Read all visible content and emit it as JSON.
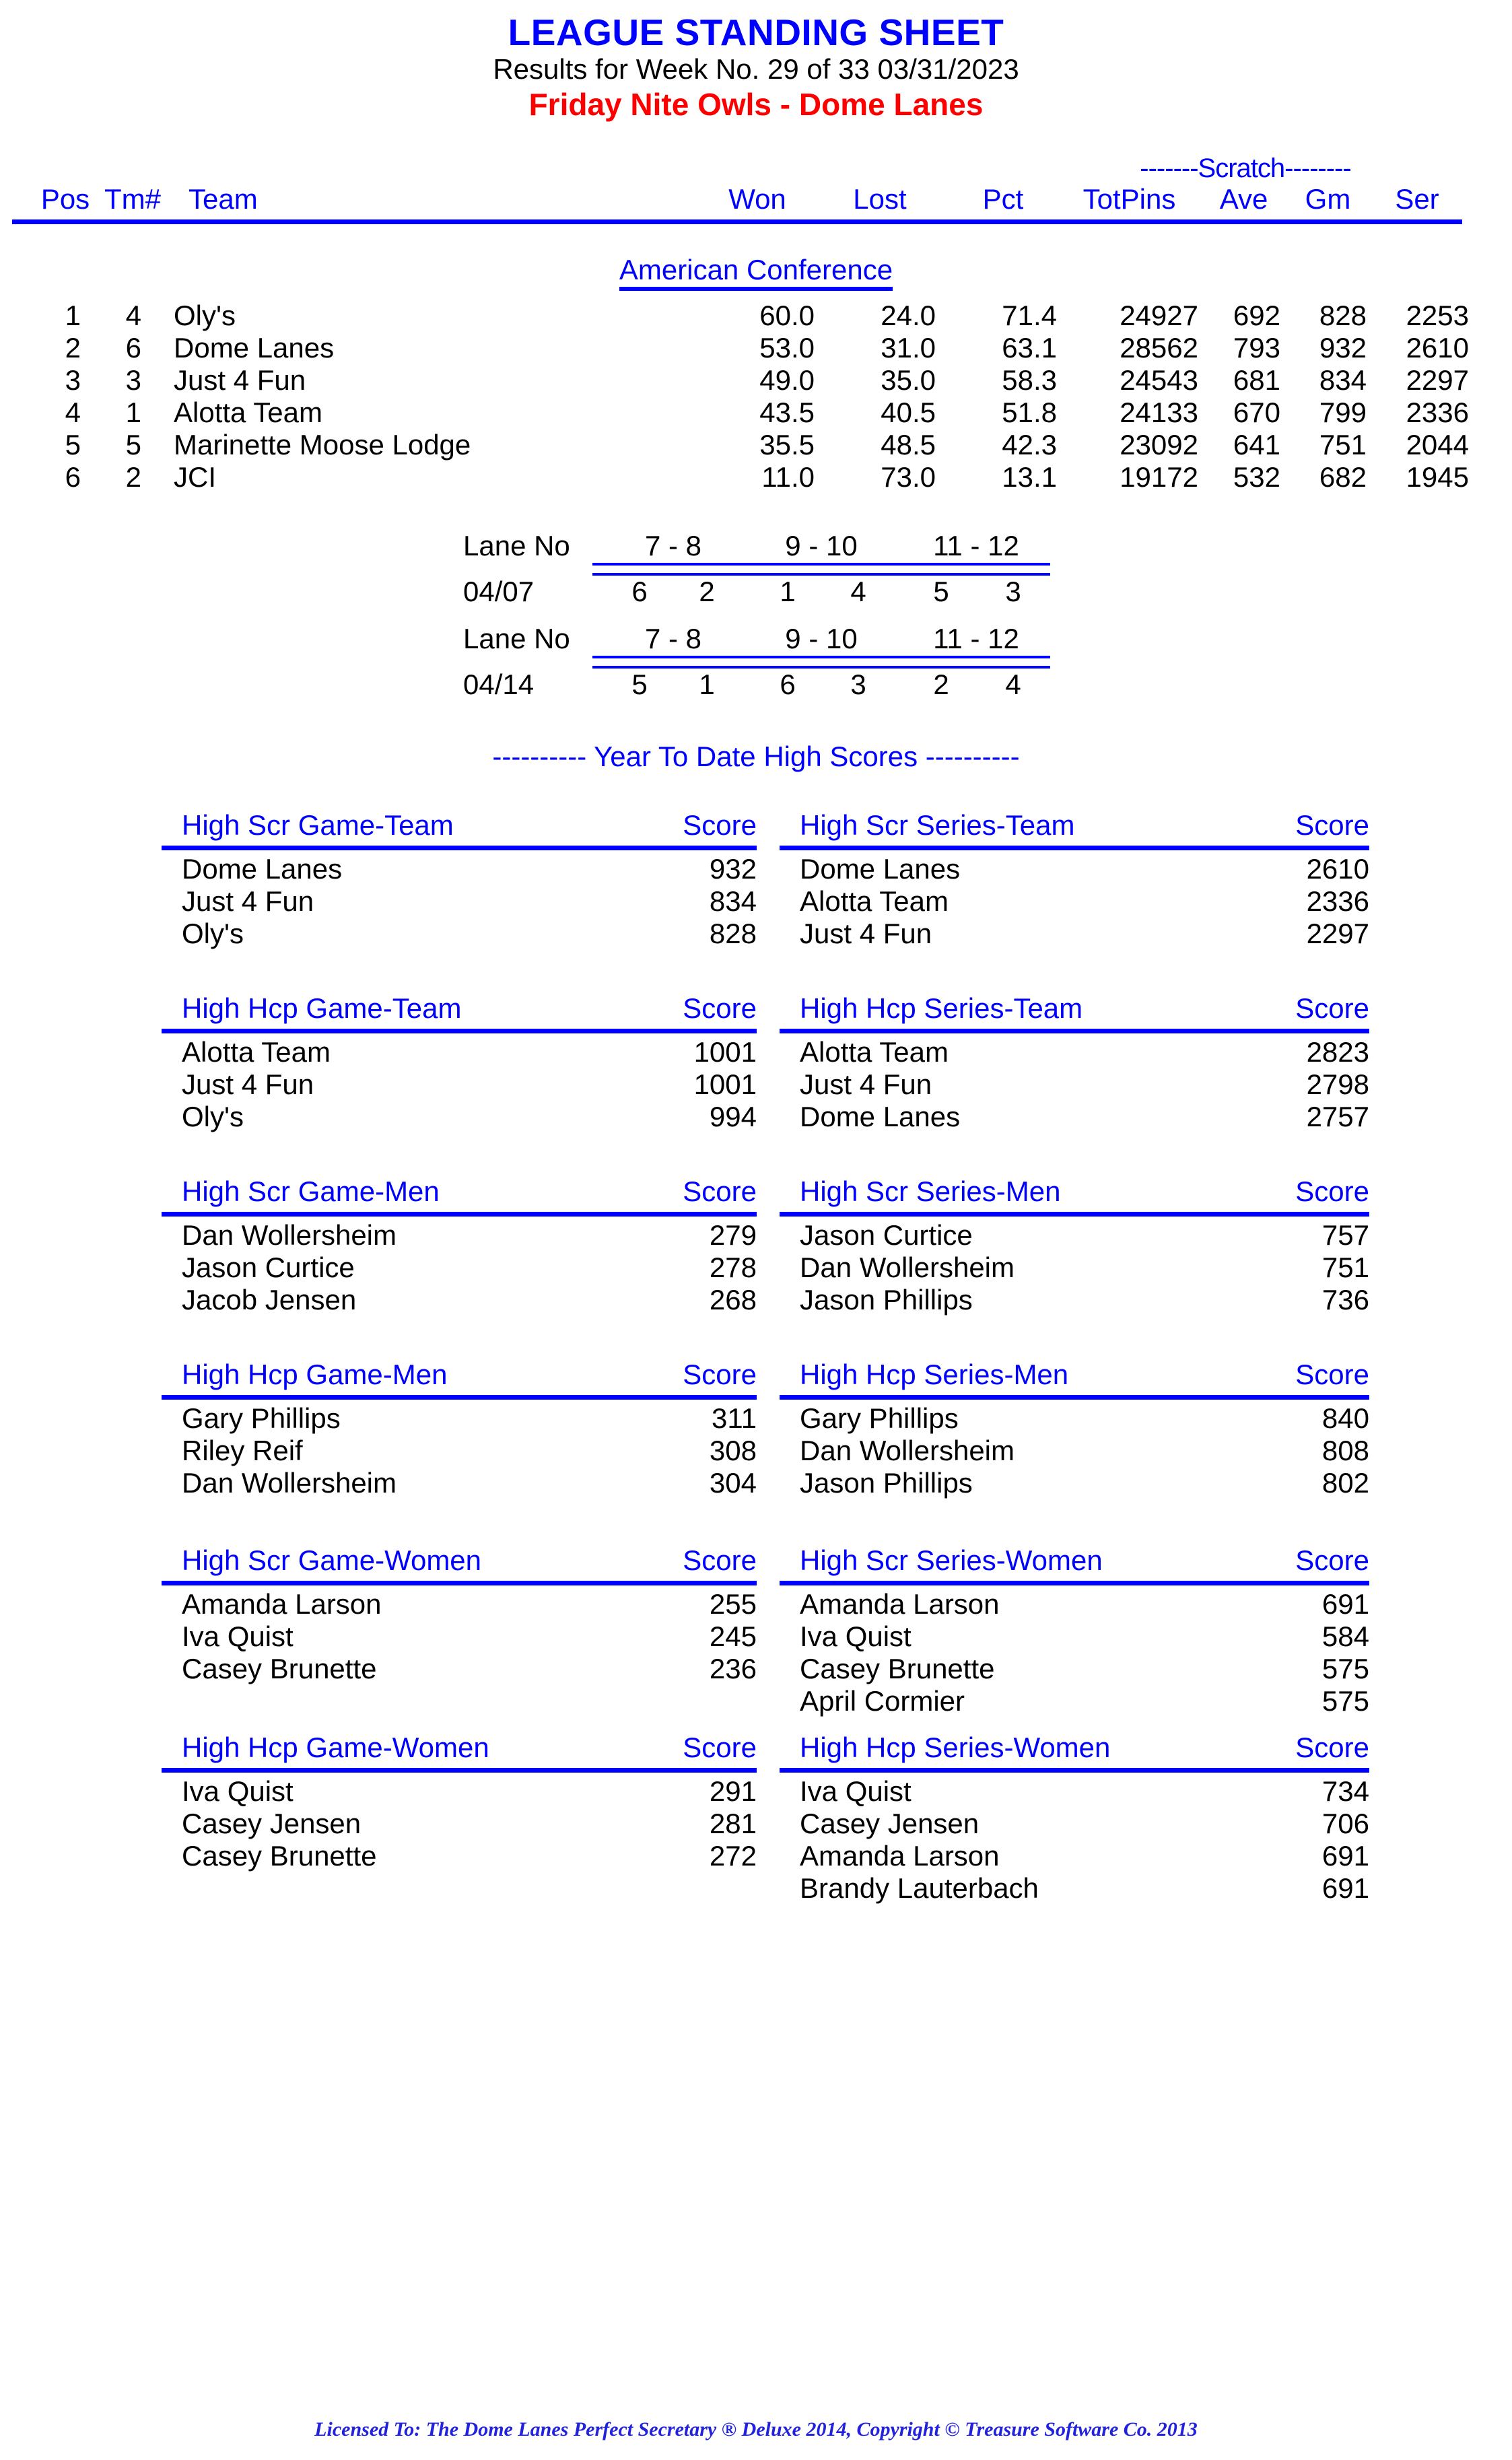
{
  "header": {
    "main_title": "LEAGUE STANDING SHEET",
    "sub_title": "Results for Week No. 29 of 33    03/31/2023",
    "league_title": "Friday Nite Owls - Dome Lanes",
    "title_color": "#0000ff",
    "league_color": "#ff0000"
  },
  "standings": {
    "scratch_label": "-------Scratch--------",
    "conference": "American Conference",
    "columns": {
      "pos": "Pos",
      "tm": "Tm#",
      "team": "Team",
      "won": "Won",
      "lost": "Lost",
      "pct": "Pct",
      "totpins": "TotPins",
      "ave": "Ave",
      "gm": "Gm",
      "ser": "Ser"
    },
    "rows": [
      {
        "pos": "1",
        "tm": "4",
        "team": "Oly's",
        "won": "60.0",
        "lost": "24.0",
        "pct": "71.4",
        "totpins": "24927",
        "ave": "692",
        "gm": "828",
        "ser": "2253"
      },
      {
        "pos": "2",
        "tm": "6",
        "team": "Dome Lanes",
        "won": "53.0",
        "lost": "31.0",
        "pct": "63.1",
        "totpins": "28562",
        "ave": "793",
        "gm": "932",
        "ser": "2610"
      },
      {
        "pos": "3",
        "tm": "3",
        "team": "Just 4 Fun",
        "won": "49.0",
        "lost": "35.0",
        "pct": "58.3",
        "totpins": "24543",
        "ave": "681",
        "gm": "834",
        "ser": "2297"
      },
      {
        "pos": "4",
        "tm": "1",
        "team": "Alotta Team",
        "won": "43.5",
        "lost": "40.5",
        "pct": "51.8",
        "totpins": "24133",
        "ave": "670",
        "gm": "799",
        "ser": "2336"
      },
      {
        "pos": "5",
        "tm": "5",
        "team": "Marinette Moose Lodge",
        "won": "35.5",
        "lost": "48.5",
        "pct": "42.3",
        "totpins": "23092",
        "ave": "641",
        "gm": "751",
        "ser": "2044"
      },
      {
        "pos": "6",
        "tm": "2",
        "team": "JCI",
        "won": "11.0",
        "lost": "73.0",
        "pct": "13.1",
        "totpins": "19172",
        "ave": "532",
        "gm": "682",
        "ser": "1945"
      }
    ]
  },
  "lane_schedule": [
    {
      "label": "Lane No",
      "date": "04/07",
      "pairs": [
        "7 -  8",
        "9 - 10",
        "11 - 12"
      ],
      "teams": [
        "6",
        "2",
        "1",
        "4",
        "5",
        "3"
      ]
    },
    {
      "label": "Lane No",
      "date": "04/14",
      "pairs": [
        "7 -  8",
        "9 - 10",
        "11 - 12"
      ],
      "teams": [
        "5",
        "1",
        "6",
        "3",
        "2",
        "4"
      ]
    }
  ],
  "ytd": {
    "title": "---------- Year To Date High Scores ----------",
    "score_label": "Score",
    "blocks": [
      {
        "left": {
          "title": "High Scr Game-Team",
          "score_label": "Score",
          "rows": [
            {
              "name": "Dome Lanes",
              "score": "932"
            },
            {
              "name": "Just 4 Fun",
              "score": "834"
            },
            {
              "name": "Oly's",
              "score": "828"
            }
          ]
        },
        "right": {
          "title": "High Scr Series-Team",
          "score_label": "Score",
          "rows": [
            {
              "name": "Dome Lanes",
              "score": "2610"
            },
            {
              "name": "Alotta Team",
              "score": "2336"
            },
            {
              "name": "Just 4 Fun",
              "score": "2297"
            }
          ]
        }
      },
      {
        "left": {
          "title": "High Hcp Game-Team",
          "score_label": "Score",
          "rows": [
            {
              "name": "Alotta Team",
              "score": "1001"
            },
            {
              "name": "Just 4 Fun",
              "score": "1001"
            },
            {
              "name": "Oly's",
              "score": "994"
            }
          ]
        },
        "right": {
          "title": "High Hcp Series-Team",
          "score_label": "Score",
          "rows": [
            {
              "name": "Alotta Team",
              "score": "2823"
            },
            {
              "name": "Just 4 Fun",
              "score": "2798"
            },
            {
              "name": "Dome Lanes",
              "score": "2757"
            }
          ]
        }
      },
      {
        "left": {
          "title": "High Scr Game-Men",
          "score_label": "Score",
          "rows": [
            {
              "name": "Dan Wollersheim",
              "score": "279"
            },
            {
              "name": "Jason Curtice",
              "score": "278"
            },
            {
              "name": "Jacob Jensen",
              "score": "268"
            }
          ]
        },
        "right": {
          "title": "High Scr Series-Men",
          "score_label": "Score",
          "rows": [
            {
              "name": "Jason Curtice",
              "score": "757"
            },
            {
              "name": "Dan Wollersheim",
              "score": "751"
            },
            {
              "name": "Jason Phillips",
              "score": "736"
            }
          ]
        }
      },
      {
        "left": {
          "title": "High Hcp Game-Men",
          "score_label": "Score",
          "rows": [
            {
              "name": "Gary Phillips",
              "score": "311"
            },
            {
              "name": "Riley Reif",
              "score": "308"
            },
            {
              "name": "Dan Wollersheim",
              "score": "304"
            }
          ]
        },
        "right": {
          "title": "High Hcp Series-Men",
          "score_label": "Score",
          "rows": [
            {
              "name": "Gary Phillips",
              "score": "840"
            },
            {
              "name": "Dan Wollersheim",
              "score": "808"
            },
            {
              "name": "Jason Phillips",
              "score": "802"
            }
          ]
        }
      },
      {
        "left": {
          "title": "High Scr Game-Women",
          "score_label": "Score",
          "rows": [
            {
              "name": "Amanda Larson",
              "score": "255"
            },
            {
              "name": "Iva Quist",
              "score": "245"
            },
            {
              "name": "Casey Brunette",
              "score": "236"
            }
          ]
        },
        "right": {
          "title": "High Scr Series-Women",
          "score_label": "Score",
          "rows": [
            {
              "name": "Amanda Larson",
              "score": "691"
            },
            {
              "name": "Iva Quist",
              "score": "584"
            },
            {
              "name": "Casey Brunette",
              "score": "575"
            },
            {
              "name": "April Cormier",
              "score": "575"
            }
          ]
        }
      },
      {
        "left": {
          "title": "High Hcp Game-Women",
          "score_label": "Score",
          "rows": [
            {
              "name": "Iva Quist",
              "score": "291"
            },
            {
              "name": "Casey Jensen",
              "score": "281"
            },
            {
              "name": "Casey Brunette",
              "score": "272"
            }
          ]
        },
        "right": {
          "title": "High Hcp Series-Women",
          "score_label": "Score",
          "rows": [
            {
              "name": "Iva Quist",
              "score": "734"
            },
            {
              "name": "Casey Jensen",
              "score": "706"
            },
            {
              "name": "Amanda Larson",
              "score": "691"
            },
            {
              "name": "Brandy Lauterbach",
              "score": "691"
            }
          ]
        }
      }
    ]
  },
  "footer": {
    "text": "Licensed To: The Dome Lanes    Perfect Secretary ® Deluxe  2014, Copyright © Treasure Software Co. 2013"
  }
}
